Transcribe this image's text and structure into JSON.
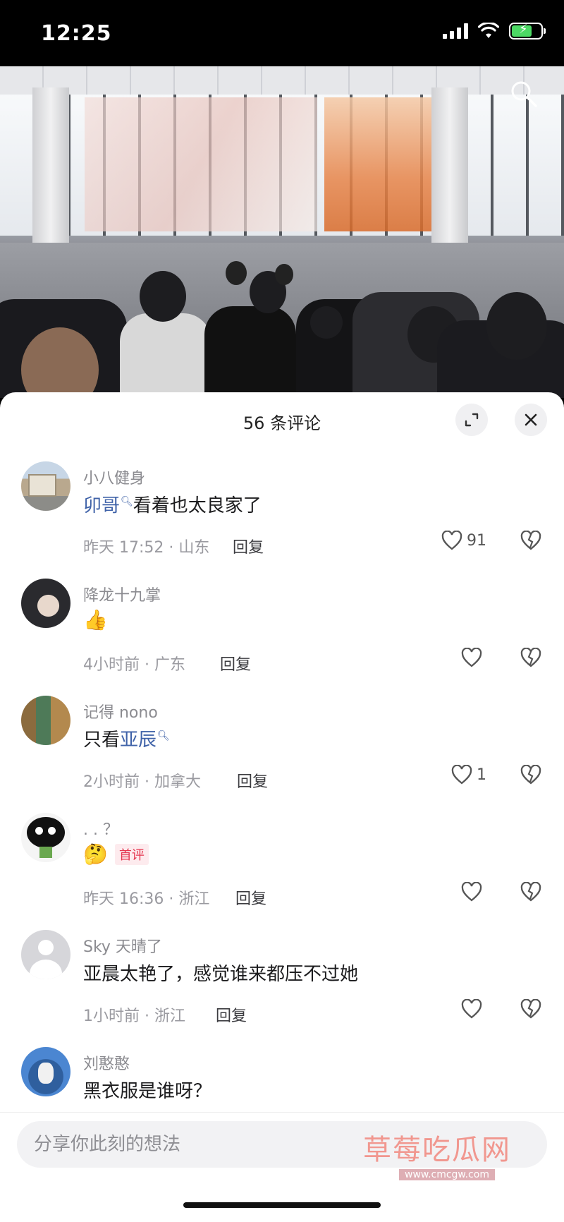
{
  "status_bar": {
    "time": "12:25"
  },
  "video": {
    "icon": "search-icon"
  },
  "sheet": {
    "title": "56 条评论",
    "expand_icon": "expand-icon",
    "close_icon": "close-icon"
  },
  "comments": [
    {
      "username": "小八健身",
      "mention": "卯哥",
      "text": "看着也太良家了",
      "time": "昨天 17:52 · 山东",
      "reply": "回复",
      "likes": "91"
    },
    {
      "username": "降龙十九掌",
      "emoji": "👍",
      "time": "4小时前 · 广东",
      "reply": "回复",
      "likes": ""
    },
    {
      "username": "记得 nono",
      "text_prefix": "只看",
      "mention": "亚辰",
      "time": "2小时前 · 加拿大",
      "reply": "回复",
      "likes": "1"
    },
    {
      "username": ". . ？",
      "emoji": "🤔",
      "badge": "首评",
      "time": "昨天 16:36 · 浙江",
      "reply": "回复",
      "likes": ""
    },
    {
      "username": "Sky 天晴了",
      "text": "亚晨太艳了，感觉谁来都压不过她",
      "time": "1小时前 · 浙江",
      "reply": "回复",
      "likes": ""
    },
    {
      "username": "刘憨憨",
      "text": "黑衣服是谁呀？"
    }
  ],
  "input": {
    "placeholder": "分享你此刻的想法"
  },
  "watermark": {
    "main": "草莓吃瓜网",
    "url": "www.cmcgw.com"
  },
  "colors": {
    "mention": "#3f62a8",
    "badge": "#e5364f",
    "battery": "#4cd964"
  }
}
